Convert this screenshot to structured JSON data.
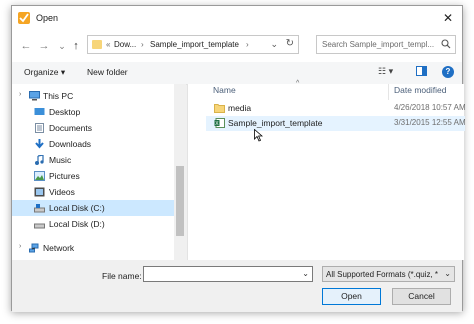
{
  "window": {
    "title": "Open",
    "close_glyph": "✕"
  },
  "nav": {
    "back": "←",
    "forward": "→",
    "recent": "⌄",
    "up": "↑",
    "breadcrumb": [
      "Dow...",
      "Sample_import_template"
    ],
    "overflow": "«",
    "separator": "›",
    "address_chevron": "⌄",
    "refresh": "↻",
    "search_placeholder": "Search Sample_import_templ..."
  },
  "toolbar": {
    "organize": "Organize ▾",
    "new_folder": "New folder",
    "view_options": "☷ ▾",
    "help": "?"
  },
  "sidebar": {
    "items": [
      {
        "label": "This PC",
        "icon": "computer-icon"
      },
      {
        "label": "Desktop",
        "icon": "desktop-folder-icon"
      },
      {
        "label": "Documents",
        "icon": "documents-folder-icon"
      },
      {
        "label": "Downloads",
        "icon": "downloads-folder-icon"
      },
      {
        "label": "Music",
        "icon": "music-folder-icon"
      },
      {
        "label": "Pictures",
        "icon": "pictures-folder-icon"
      },
      {
        "label": "Videos",
        "icon": "videos-folder-icon"
      },
      {
        "label": "Local Disk (C:)",
        "icon": "drive-icon"
      },
      {
        "label": "Local Disk (D:)",
        "icon": "drive-icon"
      },
      {
        "label": "Network",
        "icon": "network-icon"
      }
    ],
    "expand_glyph": "›"
  },
  "columns": {
    "name": "Name",
    "date_modified": "Date modified",
    "sort_glyph": "^"
  },
  "files": [
    {
      "name": "media",
      "date": "4/26/2018 10:57 AM",
      "icon": "folder-icon"
    },
    {
      "name": "Sample_import_template",
      "date": "3/31/2015 12:55 AM",
      "icon": "excel-file-icon"
    }
  ],
  "footer": {
    "file_name_label": "File name:",
    "file_name_value": "",
    "file_type": "All Supported Formats (*.quiz, *",
    "dropdown_glyph": "⌄",
    "open": "Open",
    "cancel": "Cancel"
  },
  "colors": {
    "selection": "#cce8ff",
    "accent": "#0078d7",
    "folder": "#f7d579"
  }
}
